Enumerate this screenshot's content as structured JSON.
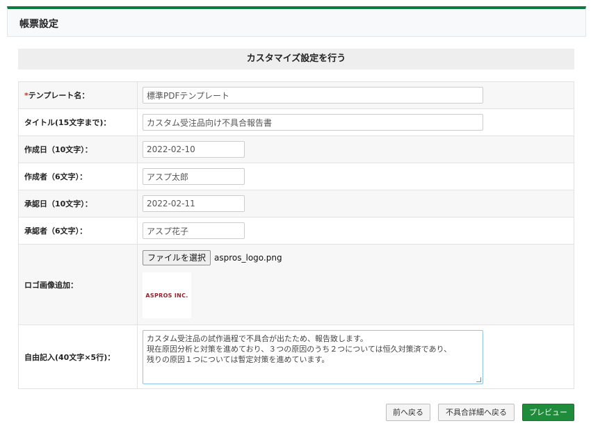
{
  "header": {
    "title": "帳票設定"
  },
  "section": {
    "title": "カスタマイズ設定を行う"
  },
  "form": {
    "required_mark": "*",
    "template_name": {
      "label": "テンプレート名：",
      "value": "標準PDFテンプレート"
    },
    "title_field": {
      "label": "タイトル(15文字まで)：",
      "value": "カスタム受注品向け不具合報告書"
    },
    "created_date": {
      "label": "作成日（10文字）：",
      "value": "2022-02-10"
    },
    "author": {
      "label": "作成者（6文字）：",
      "value": "アスプ太郎"
    },
    "approved_date": {
      "label": "承認日（10文字）：",
      "value": "2022-02-11"
    },
    "approver": {
      "label": "承認者（6文字）：",
      "value": "アスプ花子"
    },
    "logo": {
      "label": "ロゴ画像追加：",
      "button": "ファイルを選択",
      "filename": "aspros_logo.png",
      "logo_text": "ASPROS INC."
    },
    "free_text": {
      "label": "自由記入(40文字×5行)：",
      "lines": [
        "カスタム受注品の試作過程で不具合が出たため、報告致します。",
        "現在原因分析と対策を進めており、３つの原因のうち２つについては恒久対策済であり、",
        "残りの原因１つについては暫定対策を進めています。"
      ]
    }
  },
  "buttons": {
    "prev": "前へ戻る",
    "back_to_detail": "不具合詳細へ戻る",
    "preview": "プレビュー"
  },
  "colors": {
    "accent_green": "#0d7a3e",
    "preview_button": "#1f8c3b",
    "required": "#c0392b",
    "logo_red": "#9b1c2a"
  }
}
